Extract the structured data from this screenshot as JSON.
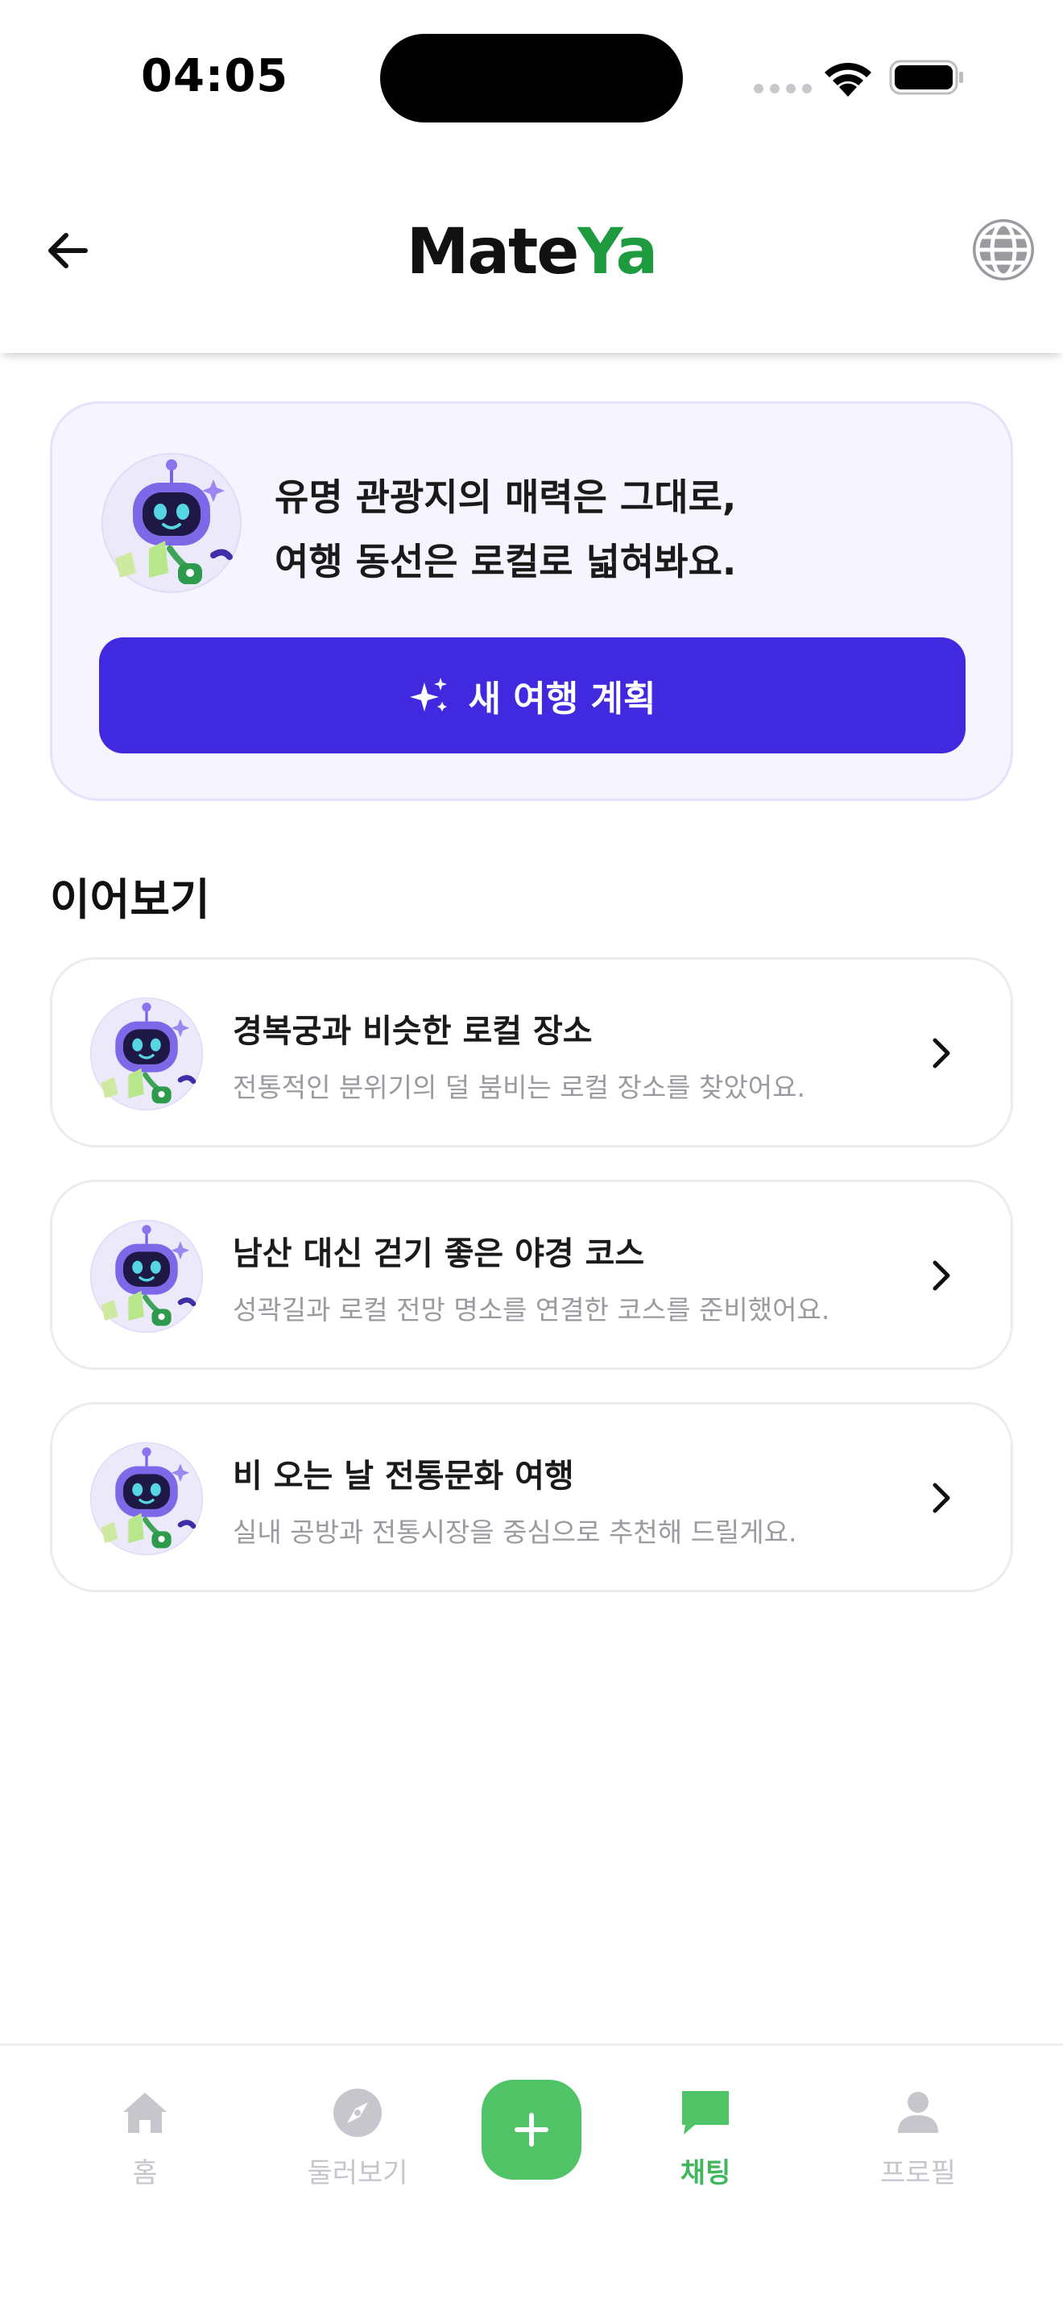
{
  "status": {
    "time": "04:05"
  },
  "header": {
    "brand_part1": "Mate",
    "brand_part2": "Ya"
  },
  "hero": {
    "line1": "유명 관광지의 매력은 그대로,",
    "line2": "여행 동선은 로컬로 넓혀봐요.",
    "button_label": "새 여행 계획"
  },
  "section": {
    "title": "이어보기"
  },
  "chats": [
    {
      "title": "경복궁과 비슷한 로컬 장소",
      "subtitle": "전통적인 분위기의 덜 붐비는 로컬 장소를 찾았어요."
    },
    {
      "title": "남산 대신 걷기 좋은 야경 코스",
      "subtitle": "성곽길과 로컬 전망 명소를 연결한 코스를 준비했어요."
    },
    {
      "title": "비 오는 날 전통문화 여행",
      "subtitle": "실내 공방과 전통시장을 중심으로 추천해 드릴게요."
    }
  ],
  "tabs": {
    "home": "홈",
    "explore": "둘러보기",
    "chat": "채팅",
    "profile": "프로필"
  },
  "colors": {
    "brand_green": "#1e9a3f",
    "primary_button": "#4129e0",
    "tab_active": "#3fb75a",
    "add_button": "#4fc365",
    "hero_bg": "#f6f4ff"
  },
  "icons": {
    "back": "arrow-left-icon",
    "globe": "globe-icon",
    "sparkle": "sparkle-icon",
    "chevron": "chevron-right-icon",
    "home": "home-icon",
    "explore": "compass-icon",
    "add": "plus-icon",
    "chat": "chat-bubble-icon",
    "profile": "person-icon"
  }
}
